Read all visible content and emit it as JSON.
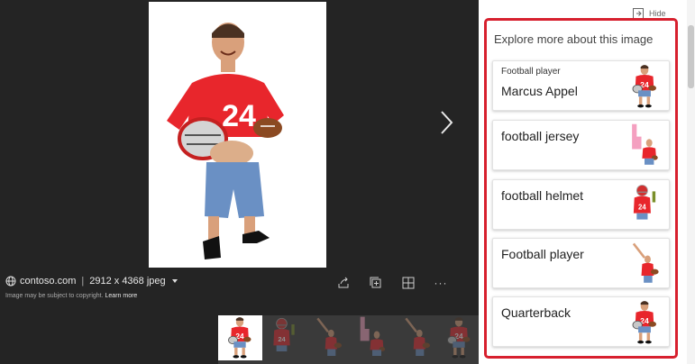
{
  "source": {
    "domain": "contoso.com",
    "separator": "|",
    "dimensions": "2912 x 4368 jpeg"
  },
  "copyright": {
    "text": "Image may be subject to copyright.",
    "link": "Learn more"
  },
  "actions": [
    {
      "name": "share-icon"
    },
    {
      "name": "collection-icon"
    },
    {
      "name": "visual-search-icon"
    },
    {
      "name": "more-options-icon",
      "glyph": "···"
    }
  ],
  "thumbnails": [
    {
      "selected": true
    },
    {
      "selected": false
    },
    {
      "selected": false
    },
    {
      "selected": false
    },
    {
      "selected": false
    },
    {
      "selected": false
    }
  ],
  "panel": {
    "hide_label": "Hide",
    "title": "Explore more about this image",
    "cards": [
      {
        "subtitle": "Football player",
        "label": "Marcus Appel"
      },
      {
        "label": "football jersey"
      },
      {
        "label": "football helmet"
      },
      {
        "label": "Football player"
      },
      {
        "label": "Quarterback"
      }
    ]
  },
  "colors": {
    "viewer_bg": "#242424",
    "highlight_border": "#d7202e",
    "jersey_red": "#e8262c"
  }
}
